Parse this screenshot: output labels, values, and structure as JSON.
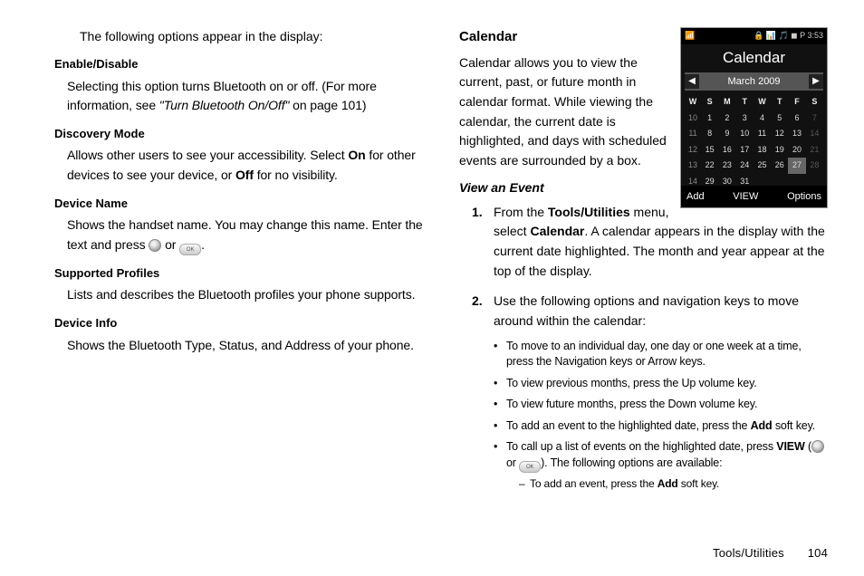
{
  "left": {
    "intro": "The following options appear in the display:",
    "enable_head": "Enable/Disable",
    "enable_body_a": "Selecting this option turns Bluetooth on or off.  (For more information, see ",
    "enable_body_ref": "\"Turn Bluetooth On/Off\"",
    "enable_body_b": " on page 101)",
    "discovery_head": "Discovery Mode",
    "discovery_body_a": "Allows other users to see your accessibility. Select ",
    "discovery_on": "On",
    "discovery_body_b": " for other devices to see your device, or ",
    "discovery_off": "Off",
    "discovery_body_c": " for no visibility.",
    "devname_head": "Device Name",
    "devname_body_a": "Shows the handset name. You may change this name. Enter the text and press ",
    "devname_body_or": " or ",
    "devname_body_b": ".",
    "profiles_head": "Supported Profiles",
    "profiles_body": "Lists and describes the Bluetooth profiles your phone supports.",
    "devinfo_head": "Device Info",
    "devinfo_body": "Shows the Bluetooth Type, Status, and Address of your phone."
  },
  "right": {
    "section": "Calendar",
    "intro": "Calendar allows you to view the current, past, or future month in calendar format. While viewing the calendar, the current date is highlighted, and days with scheduled events are surrounded by a box.",
    "view_head": "View an Event",
    "step1_a": "From the ",
    "step1_b": "Tools/Utilities",
    "step1_c": " menu, select ",
    "step1_d": "Calendar",
    "step1_e": ". A calendar appears in the display with the current date highlighted. The month and year appear at the top of the display.",
    "step2": "Use the following options and navigation keys to move around within the calendar:",
    "b1": "To move to an individual day, one day or one week at a time, press the Navigation keys or Arrow keys.",
    "b2": "To view previous months, press the Up volume key.",
    "b3": "To view future months, press the Down volume key.",
    "b4_a": "To add an event to the highlighted date, press the ",
    "b4_b": "Add",
    "b4_c": " soft key.",
    "b5_a": "To call up a list of events on the highlighted date, press ",
    "b5_b": "VIEW",
    "b5_c": " (",
    "b5_or": " or ",
    "b5_d": "). The following options are available:",
    "dash_a": "To add an event, press the ",
    "dash_b": "Add",
    "dash_c": " soft key."
  },
  "phone": {
    "status_left": "📶",
    "status_right": "🔒 📊 🎵 ◼ P 3:53",
    "title": "Calendar",
    "month": "March 2009",
    "days": [
      "W",
      "S",
      "M",
      "T",
      "W",
      "T",
      "F",
      "S"
    ],
    "rows": [
      {
        "wk": "10",
        "cells": [
          "1",
          "2",
          "3",
          "4",
          "5",
          "6",
          "7"
        ],
        "dim": [
          6
        ]
      },
      {
        "wk": "11",
        "cells": [
          "8",
          "9",
          "10",
          "11",
          "12",
          "13",
          "14"
        ],
        "dim": [
          6
        ]
      },
      {
        "wk": "12",
        "cells": [
          "15",
          "16",
          "17",
          "18",
          "19",
          "20",
          "21"
        ],
        "dim": [
          6
        ]
      },
      {
        "wk": "13",
        "cells": [
          "22",
          "23",
          "24",
          "25",
          "26",
          "27",
          "28"
        ],
        "hl": 5,
        "dim": [
          6
        ]
      },
      {
        "wk": "14",
        "cells": [
          "29",
          "30",
          "31",
          "",
          "",
          "",
          ""
        ],
        "dim": []
      }
    ],
    "sk_left": "Add",
    "sk_mid": "VIEW",
    "sk_right": "Options"
  },
  "footer": {
    "section": "Tools/Utilities",
    "page": "104"
  }
}
